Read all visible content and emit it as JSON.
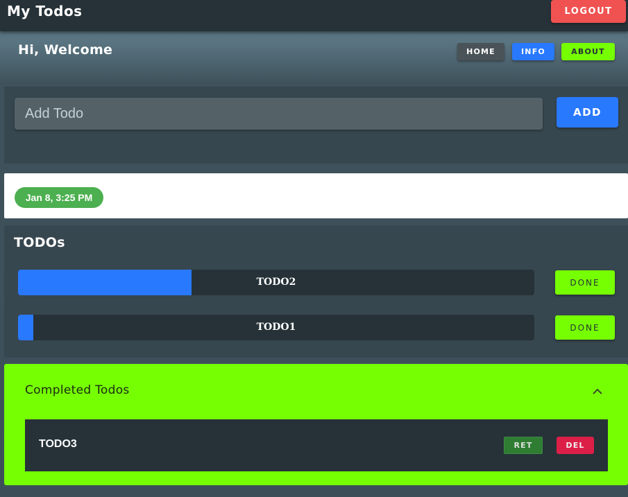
{
  "app": {
    "title": "My Todos",
    "logout_label": "LOGOUT"
  },
  "header": {
    "welcome": "Hi, Welcome",
    "nav": [
      {
        "label": "HOME",
        "color": "#4a5357"
      },
      {
        "label": "INFO",
        "color": "#2979ff"
      },
      {
        "label": "ABOUT",
        "color": "#76ff03"
      }
    ]
  },
  "add_todo": {
    "placeholder": "Add Todo",
    "value": "",
    "button_label": "ADD"
  },
  "date": {
    "label": "Jan 8, 3:25 PM"
  },
  "todos": {
    "heading": "TODOs",
    "items": [
      {
        "label": "TODO2",
        "progress": 0.336,
        "done_label": "DONE"
      },
      {
        "label": "TODO1",
        "progress": 0.004,
        "done_label": "DONE"
      }
    ]
  },
  "completed": {
    "title": "Completed Todos",
    "expanded": true,
    "icon": "chevron-up-icon",
    "items": [
      {
        "label": "TODO3",
        "ret_label": "RET",
        "del_label": "DEL"
      }
    ]
  },
  "colors": {
    "accent_blue": "#2979ff",
    "accent_green": "#76ff03",
    "danger": "#f05252",
    "delete": "#dc1f47",
    "chip_green": "#4caf50",
    "panel": "#37474f",
    "bar_dark": "#263238"
  }
}
